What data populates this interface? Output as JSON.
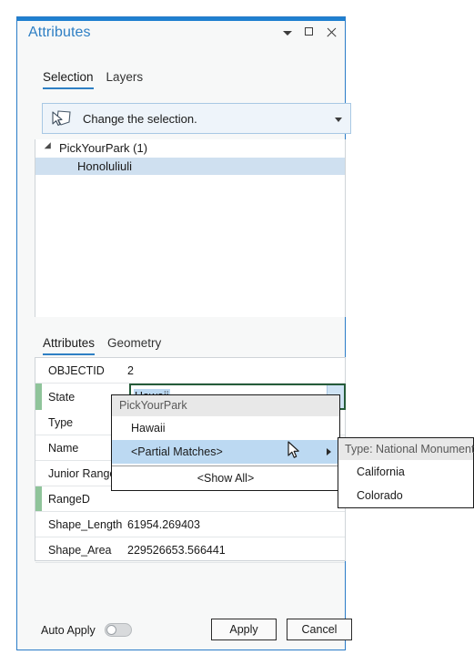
{
  "window": {
    "title": "Attributes",
    "controls": [
      {
        "name": "menu-caret-icon",
        "glyph": "caret-down"
      },
      {
        "name": "maximize-icon",
        "glyph": "square"
      },
      {
        "name": "close-icon",
        "glyph": "x"
      }
    ]
  },
  "top_tabs": [
    {
      "label": "Selection",
      "active": true
    },
    {
      "label": "Layers",
      "active": false
    }
  ],
  "selection_combo": {
    "icon": "select-features-icon",
    "label": "Change the selection.",
    "caret": "caret-down-icon"
  },
  "tree": {
    "root": "PickYourPark (1)",
    "children": [
      {
        "label": "Honoluliuli",
        "selected": true
      }
    ]
  },
  "attr_tabs": [
    {
      "label": "Attributes",
      "active": true
    },
    {
      "label": "Geometry",
      "active": false
    }
  ],
  "attributes": {
    "rows": [
      {
        "name": "OBJECTID",
        "value": "2",
        "dirty": false,
        "editing": false
      },
      {
        "name": "State",
        "value": "Hawaii",
        "dirty": true,
        "editing": true
      },
      {
        "name": "Type",
        "value": "",
        "dirty": false,
        "editing": false
      },
      {
        "name": "Name",
        "value": "",
        "dirty": false,
        "editing": false
      },
      {
        "name": "Junior Ranger",
        "value": "",
        "dirty": false,
        "editing": false
      },
      {
        "name": "RangeD",
        "value": "",
        "dirty": true,
        "editing": false
      },
      {
        "name": "Shape_Length",
        "value": "61954.269403",
        "dirty": false,
        "editing": false
      },
      {
        "name": "Shape_Area",
        "value": "229526653.566441",
        "dirty": false,
        "editing": false
      }
    ]
  },
  "dropdown": {
    "header": "PickYourPark",
    "items": [
      {
        "label": "Hawaii",
        "highlighted": false,
        "submenu": false
      },
      {
        "label": "<Partial Matches>",
        "highlighted": true,
        "submenu": true
      }
    ],
    "show_all": "<Show All>"
  },
  "submenu": {
    "header": "Type: National Monument",
    "items": [
      {
        "label": "California"
      },
      {
        "label": "Colorado"
      }
    ]
  },
  "footer": {
    "auto_apply_label": "Auto Apply",
    "auto_apply_on": false,
    "apply_label": "Apply",
    "cancel_label": "Cancel"
  },
  "colors": {
    "accent": "#1f80d0",
    "title": "#2e7fc4",
    "selection_highlight": "#cfe0f0",
    "edit_border": "#265c3a",
    "dirty_marker": "#8fc49a",
    "menu_highlight": "#bcd9f2"
  }
}
